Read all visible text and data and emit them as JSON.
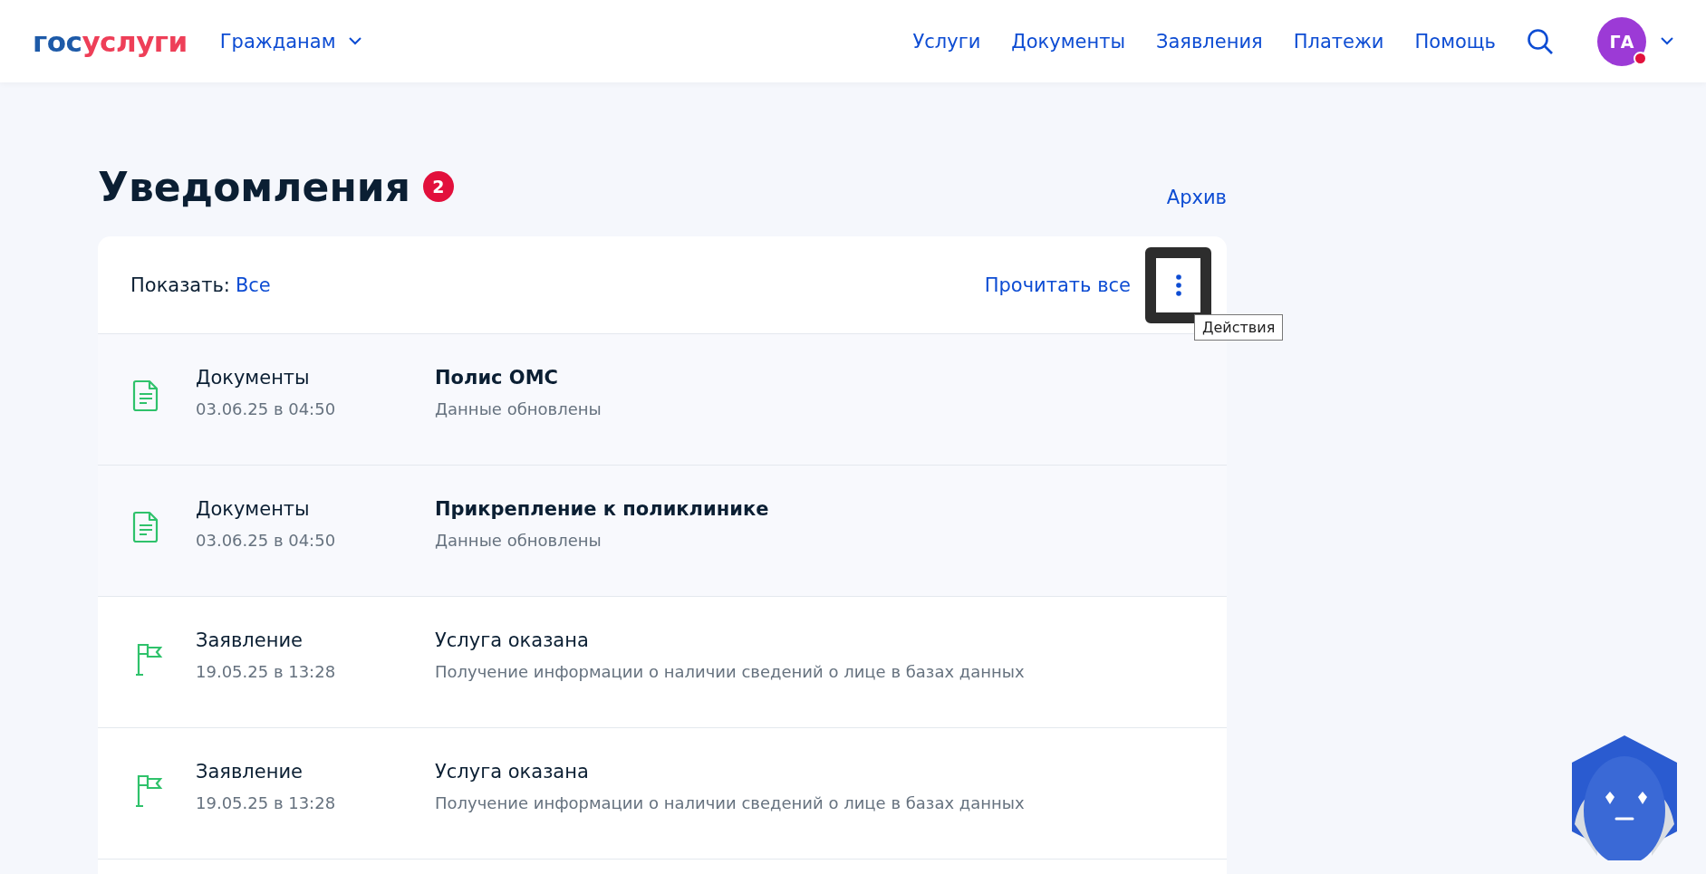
{
  "header": {
    "logo": {
      "part_1": "гос",
      "part_2": "услуги"
    },
    "audience": "Гражданам",
    "nav": [
      "Услуги",
      "Документы",
      "Заявления",
      "Платежи",
      "Помощь"
    ],
    "avatar": {
      "initials": "ГА",
      "alert": true
    }
  },
  "page": {
    "title": "Уведомления",
    "badge": "2",
    "archive_link": "Архив"
  },
  "toolbar": {
    "filter_label": "Показать:",
    "filter_value": "Все",
    "read_all": "Прочитать все",
    "actions_tooltip": "Действия"
  },
  "notifications": [
    {
      "kind": "document",
      "unread": true,
      "category": "Документы",
      "date": "03.06.25 в 04:50",
      "title": "Полис ОМС",
      "description": "Данные обновлены"
    },
    {
      "kind": "document",
      "unread": true,
      "category": "Документы",
      "date": "03.06.25 в 04:50",
      "title": "Прикрепление к поликлинике",
      "description": "Данные обновлены"
    },
    {
      "kind": "application",
      "unread": false,
      "category": "Заявление",
      "date": "19.05.25 в 13:28",
      "title": "Услуга оказана",
      "description": "Получение информации о наличии сведений о лице в базах данных"
    },
    {
      "kind": "application",
      "unread": false,
      "category": "Заявление",
      "date": "19.05.25 в 13:28",
      "title": "Услуга оказана",
      "description": "Получение информации о наличии сведений о лице в базах данных"
    }
  ]
}
